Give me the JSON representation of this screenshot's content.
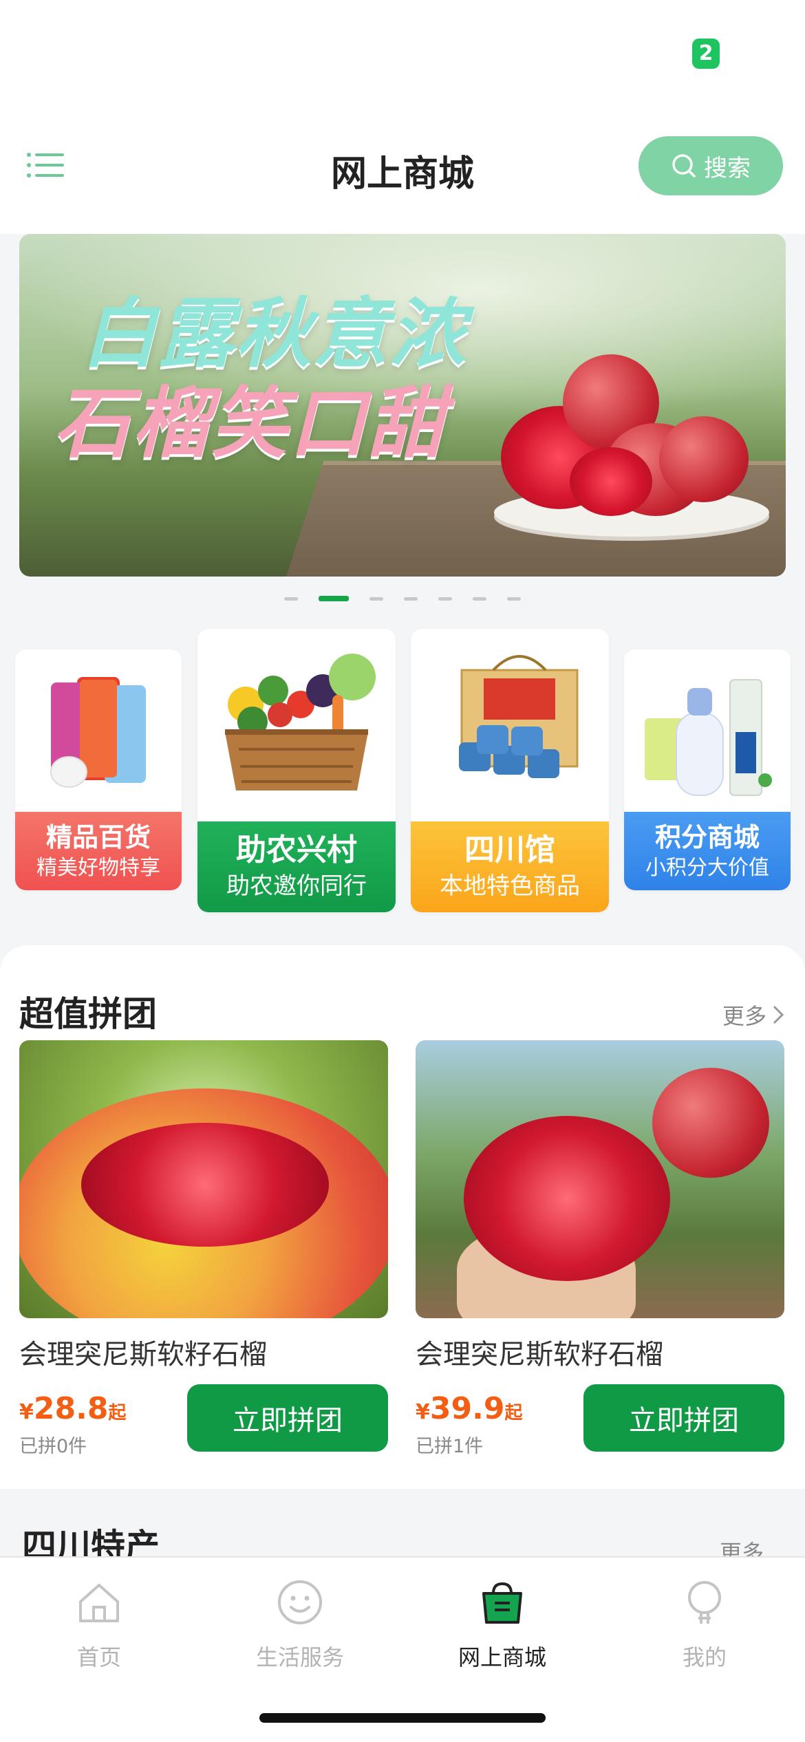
{
  "status_bar": {
    "indicator": "2"
  },
  "header": {
    "title": "网上商城",
    "search_label": "搜索"
  },
  "banner": {
    "headline_line1": "白露秋意浓",
    "headline_line2": "石榴笑口甜",
    "slide_count": 7,
    "active_slide": 2
  },
  "categories": [
    {
      "title": "精品百货",
      "subtitle": "精美好物特享",
      "color": "#f05a55"
    },
    {
      "title": "助农兴村",
      "subtitle": "助农邀你同行",
      "color": "#16a34e"
    },
    {
      "title": "四川馆",
      "subtitle": "本地特色商品",
      "color": "#fbb02a"
    },
    {
      "title": "积分商城",
      "subtitle": "小积分大价值",
      "color": "#3a8ff0"
    }
  ],
  "group_buy": {
    "title": "超值拼团",
    "more_label": "更多",
    "products": [
      {
        "name": "会理突尼斯软籽石榴",
        "currency": "¥",
        "price": "28.8",
        "price_suffix": "起",
        "sold": "已拼0件",
        "button": "立即拼团"
      },
      {
        "name": "会理突尼斯软籽石榴",
        "currency": "¥",
        "price": "39.9",
        "price_suffix": "起",
        "sold": "已拼1件",
        "button": "立即拼团"
      }
    ]
  },
  "specialty": {
    "title": "四川特产",
    "more_label": "更多"
  },
  "tabbar": {
    "items": [
      {
        "label": "首页",
        "icon": "home-icon",
        "active": false
      },
      {
        "label": "生活服务",
        "icon": "smiley-icon",
        "active": false
      },
      {
        "label": "网上商城",
        "icon": "shopping-bag-icon",
        "active": true
      },
      {
        "label": "我的",
        "icon": "user-icon",
        "active": false
      }
    ]
  },
  "colors": {
    "brand_green": "#109a46",
    "search_green": "#7fd3a4",
    "price_orange": "#f25e14"
  }
}
